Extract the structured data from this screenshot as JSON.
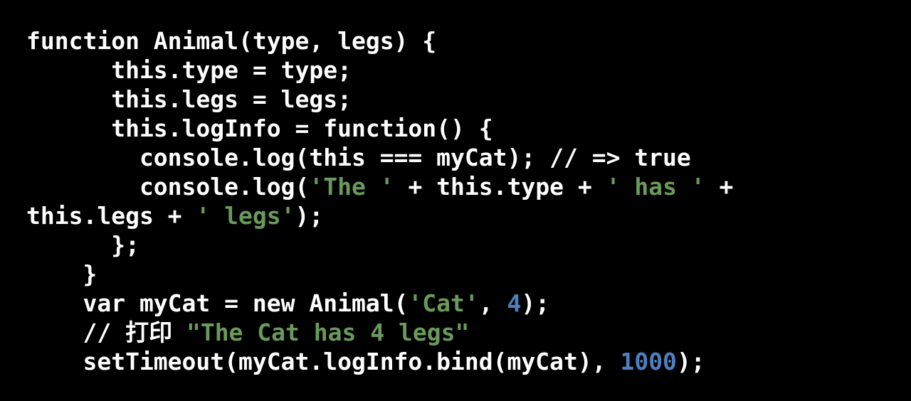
{
  "code": {
    "lines": [
      [
        {
          "t": "function Animal(type, legs) {",
          "k": "plain"
        }
      ],
      [
        {
          "t": "      this.type = type;",
          "k": "plain"
        }
      ],
      [
        {
          "t": "      this.legs = legs;",
          "k": "plain"
        }
      ],
      [
        {
          "t": "      this.logInfo = function() {",
          "k": "plain"
        }
      ],
      [
        {
          "t": "        console.log(this === myCat); // => true",
          "k": "plain"
        }
      ],
      [
        {
          "t": "        console.log(",
          "k": "plain"
        },
        {
          "t": "'The '",
          "k": "str"
        },
        {
          "t": " + this.type + ",
          "k": "plain"
        },
        {
          "t": "' has '",
          "k": "str"
        },
        {
          "t": " +",
          "k": "plain"
        }
      ],
      [
        {
          "t": "this.legs + ",
          "k": "plain"
        },
        {
          "t": "' legs'",
          "k": "str"
        },
        {
          "t": ");",
          "k": "plain"
        }
      ],
      [
        {
          "t": "      };",
          "k": "plain"
        }
      ],
      [
        {
          "t": "    }",
          "k": "plain"
        }
      ],
      [
        {
          "t": "    var myCat = new Animal(",
          "k": "plain"
        },
        {
          "t": "'Cat'",
          "k": "str"
        },
        {
          "t": ", ",
          "k": "plain"
        },
        {
          "t": "4",
          "k": "num"
        },
        {
          "t": ");",
          "k": "plain"
        }
      ],
      [
        {
          "t": "    // 打印 ",
          "k": "plain"
        },
        {
          "t": "\"The Cat has 4 legs\"",
          "k": "str"
        }
      ],
      [
        {
          "t": "    setTimeout(myCat.logInfo.bind(myCat), ",
          "k": "plain"
        },
        {
          "t": "1000",
          "k": "num"
        },
        {
          "t": ");",
          "k": "plain"
        }
      ]
    ]
  },
  "colors": {
    "background": "#000000",
    "text": "#ffffff",
    "string": "#6a9a5b",
    "number": "#4f7fbf"
  }
}
